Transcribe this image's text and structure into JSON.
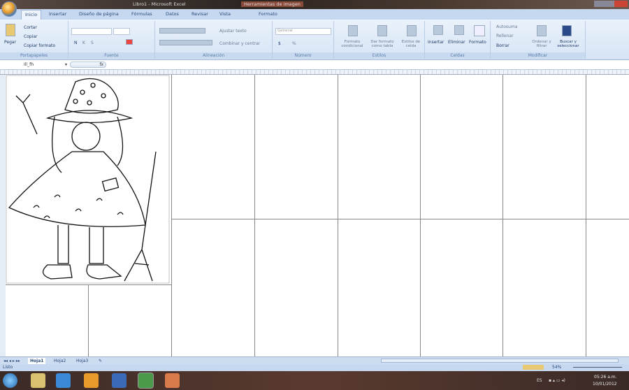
{
  "titlebar": {
    "title": "Libro1 - Microsoft Excel",
    "context_tab": "Herramientas de imagen"
  },
  "tabs": [
    {
      "label": "Inicio",
      "active": true
    },
    {
      "label": "Insertar"
    },
    {
      "label": "Diseño de página"
    },
    {
      "label": "Fórmulas"
    },
    {
      "label": "Datos"
    },
    {
      "label": "Revisar"
    },
    {
      "label": "Vista"
    },
    {
      "label": "Formato"
    }
  ],
  "ribbon": {
    "clipboard": {
      "label": "Portapapeles",
      "paste": "Pegar",
      "cut": "Cortar",
      "copy": "Copiar",
      "format_painter": "Copiar formato"
    },
    "font": {
      "label": "Fuente",
      "bold": "N",
      "italic": "K",
      "underline": "S"
    },
    "alignment": {
      "label": "Alineación",
      "wrap": "Ajustar texto",
      "merge": "Combinar y centrar"
    },
    "number": {
      "label": "Número",
      "format": "General",
      "currency": "$",
      "percent": "%"
    },
    "styles": {
      "label": "Estilos",
      "conditional": "Formato condicional",
      "as_table": "Dar formato como tabla",
      "cell_styles": "Estilos de celda"
    },
    "cells": {
      "label": "Celdas",
      "insert": "Insertar",
      "delete": "Eliminar",
      "format": "Formato"
    },
    "editing": {
      "label": "Modificar",
      "autosum": "Autosuma",
      "fill": "Rellenar",
      "clear": "Borrar",
      "sort": "Ordenar y filtrar",
      "find": "Buscar y seleccionar"
    }
  },
  "formula_bar": {
    "name_box": "Ill_fh",
    "fx": "fx",
    "value": ""
  },
  "sheets": [
    {
      "label": "Hoja1",
      "active": true
    },
    {
      "label": "Hoja2"
    },
    {
      "label": "Hoja3"
    }
  ],
  "status": {
    "text": "Listo",
    "zoom": "54%"
  },
  "taskbar": {
    "lang": "ES",
    "time": "05:26 a.m.",
    "date": "10/01/2012"
  }
}
